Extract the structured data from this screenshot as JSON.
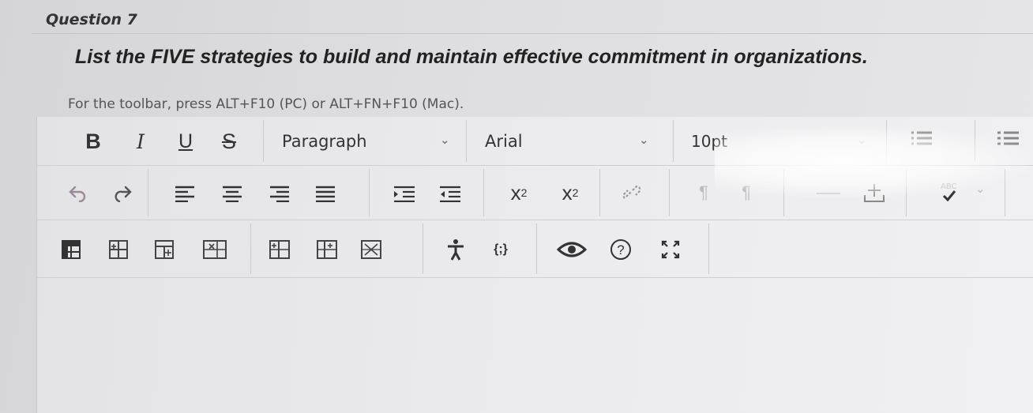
{
  "question": {
    "title": "Question 7",
    "prompt": "List the FIVE strategies to build and maintain effective commitment in organizations."
  },
  "editor": {
    "hint": "For the toolbar, press ALT+F10 (PC) or ALT+FN+F10 (Mac).",
    "toolbar": {
      "bold": "B",
      "italic": "I",
      "underline": "U",
      "strikethrough": "S",
      "block_format": "Paragraph",
      "font_family": "Arial",
      "font_size": "10pt",
      "superscript_base": "x",
      "superscript_mark": "2",
      "subscript_base": "x",
      "subscript_mark": "2",
      "code_sample": "{;}",
      "help": "?",
      "spellcheck": "ABC"
    }
  },
  "icons": [
    "undo-icon",
    "redo-icon",
    "align-left-icon",
    "align-center-icon",
    "align-right-icon",
    "align-justify-icon",
    "indent-icon",
    "outdent-icon",
    "link-icon",
    "ltr-icon",
    "rtl-icon",
    "horizontal-line-icon",
    "insert-table-icon",
    "bullet-list-icon",
    "numbered-list-icon",
    "table-icon",
    "table-row-icon",
    "table-col-icon",
    "table-props-icon",
    "accessibility-icon",
    "preview-icon",
    "fullscreen-icon"
  ],
  "colors": {
    "text": "#222222",
    "hint": "#555555",
    "toolbar_icon": "#333333",
    "background": "#e4e4e6"
  }
}
